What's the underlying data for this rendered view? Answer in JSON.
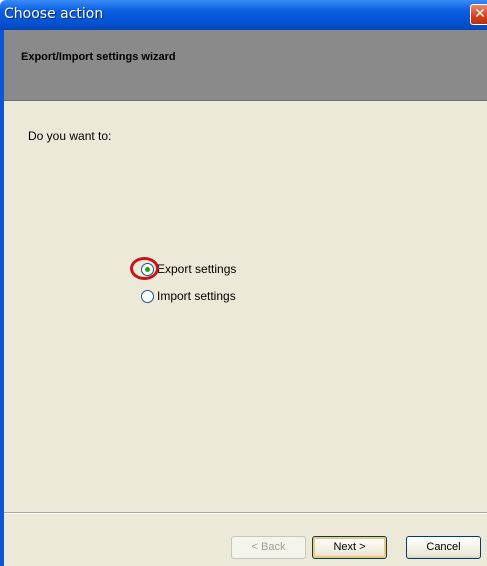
{
  "window": {
    "title": "Choose action",
    "close_glyph": "✕"
  },
  "wizard": {
    "header_title": "Export/Import settings wizard",
    "question": "Do you want to:",
    "options": [
      {
        "label": "Export settings",
        "selected": true
      },
      {
        "label": "Import settings",
        "selected": false
      }
    ]
  },
  "buttons": {
    "back": "< Back",
    "next": "Next >",
    "cancel": "Cancel"
  },
  "colors": {
    "titlebar": "#0454d6",
    "header_band": "#8a8a8a",
    "client_bg": "#ece9d8",
    "highlight_ring": "#c4161c"
  }
}
